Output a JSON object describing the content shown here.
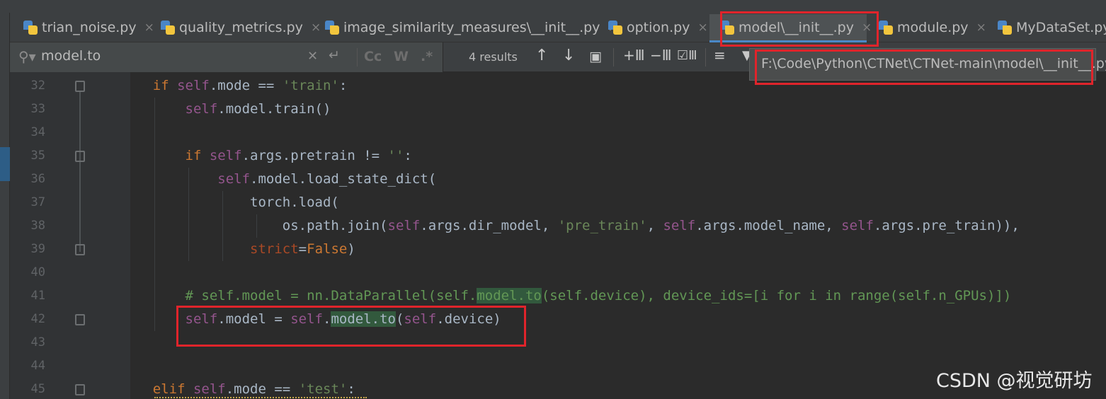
{
  "tabs": [
    {
      "label": "trian_noise.py",
      "close": "×"
    },
    {
      "label": "quality_metrics.py",
      "close": "×"
    },
    {
      "label": "image_similarity_measures\\__init__.py",
      "close": "×"
    },
    {
      "label": "option.py",
      "close": "×"
    },
    {
      "label": "model\\__init__.py",
      "close": "×",
      "active": true
    },
    {
      "label": "module.py",
      "close": "×"
    },
    {
      "label": "MyDataSet.py",
      "close": ""
    }
  ],
  "search": {
    "query": "model.to",
    "results": "4 results",
    "match_case": "Cc",
    "words": "W",
    "regex": ".*"
  },
  "tooltip": {
    "path": "F:\\Code\\Python\\CTNet\\CTNet-main\\model\\__init__.py"
  },
  "line_numbers": [
    "32",
    "33",
    "34",
    "35",
    "36",
    "37",
    "38",
    "39",
    "40",
    "41",
    "42",
    "43",
    "44",
    "45"
  ],
  "code": {
    "l32": {
      "if": "if ",
      "self": "self",
      "rest": ".mode == ",
      "str": "'train'",
      "end": ":"
    },
    "l33": {
      "self": "self",
      "rest": ".model.train()"
    },
    "l35": {
      "if": "if ",
      "self": "self",
      "rest": ".args.pretrain != ",
      "str": "''",
      "end": ":"
    },
    "l36": {
      "self": "self",
      "rest": ".model.load_state_dict("
    },
    "l37": {
      "rest": "torch.load("
    },
    "l38": {
      "a": "os.path.join(",
      "self1": "self",
      "b": ".args.dir_model, ",
      "str": "'pre_train'",
      "c": ", ",
      "self2": "self",
      "d": ".args.model_name, ",
      "self3": "self",
      "e": ".args.pre_train)),"
    },
    "l39": {
      "kwarg": "strict",
      "eq": "=",
      "val": "False",
      "end": ")"
    },
    "l41": {
      "a": "# self.model = nn.DataParallel(self.",
      "hl": "model.to",
      "b": "(self.device), device_ids=[i for i in range(self.n_GPUs)])"
    },
    "l42": {
      "self1": "self",
      "a": ".model = ",
      "self2": "self",
      "b": ".",
      "hl": "model.to",
      "c": "(",
      "self3": "self",
      "d": ".device)"
    },
    "l45": {
      "elif": "elif ",
      "self": "self",
      "rest": ".mode == ",
      "str": "'test'",
      "end": ":"
    }
  },
  "watermark": "CSDN @视觉研坊",
  "colors": {
    "keyword": "#cc7832",
    "self": "#94558d",
    "string": "#6a8759",
    "comment": "#629755",
    "highlight": "#32593d",
    "annotation": "#e0242b"
  }
}
